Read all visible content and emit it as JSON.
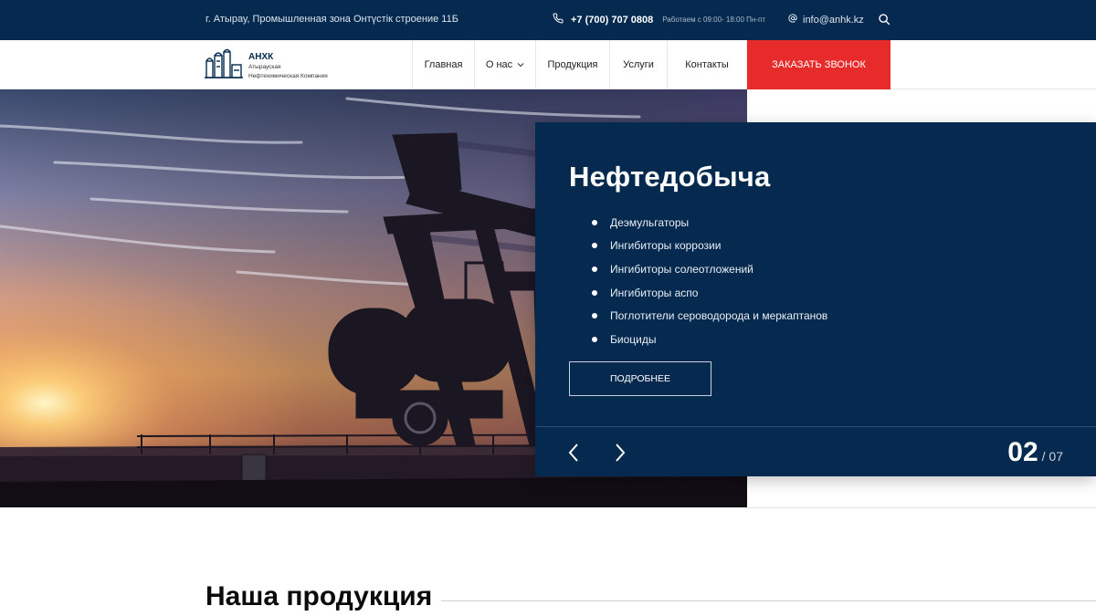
{
  "topbar": {
    "address": "г. Атырау, Промышленная зона Онтүстік строение 11Б",
    "phone": "+7 (700) 707 0808",
    "hours": "Работаем с 09:00- 18:00 Пн-пт",
    "email": "info@anhk.kz",
    "icons": [
      "phone-icon",
      "at-icon",
      "search-icon"
    ]
  },
  "logo": {
    "brand": "АНХК",
    "line1": "Атырауская",
    "line2": "Нефтехимическая Компания"
  },
  "nav": {
    "items": [
      {
        "label": "Главная"
      },
      {
        "label": "О нас"
      },
      {
        "label": "Продукция"
      },
      {
        "label": "Услуги"
      },
      {
        "label": "Контакты"
      }
    ],
    "cta": "ЗАКАЗАТЬ ЗВОНОК"
  },
  "slider": {
    "title": "Нефтедобыча",
    "items": [
      "Деэмульгаторы",
      "Ингибиторы коррозии",
      "Ингибиторы солеотложений",
      "Ингибиторы аспо",
      "Поглотители сероводорода и меркаптанов",
      "Биоциды"
    ],
    "button": "ПОДРОБНЕЕ",
    "current": "02",
    "total": "/ 07"
  },
  "section": {
    "title": "Наша продукция"
  },
  "colors": {
    "navy": "#062a4f",
    "accent_red": "#e72a2a"
  }
}
